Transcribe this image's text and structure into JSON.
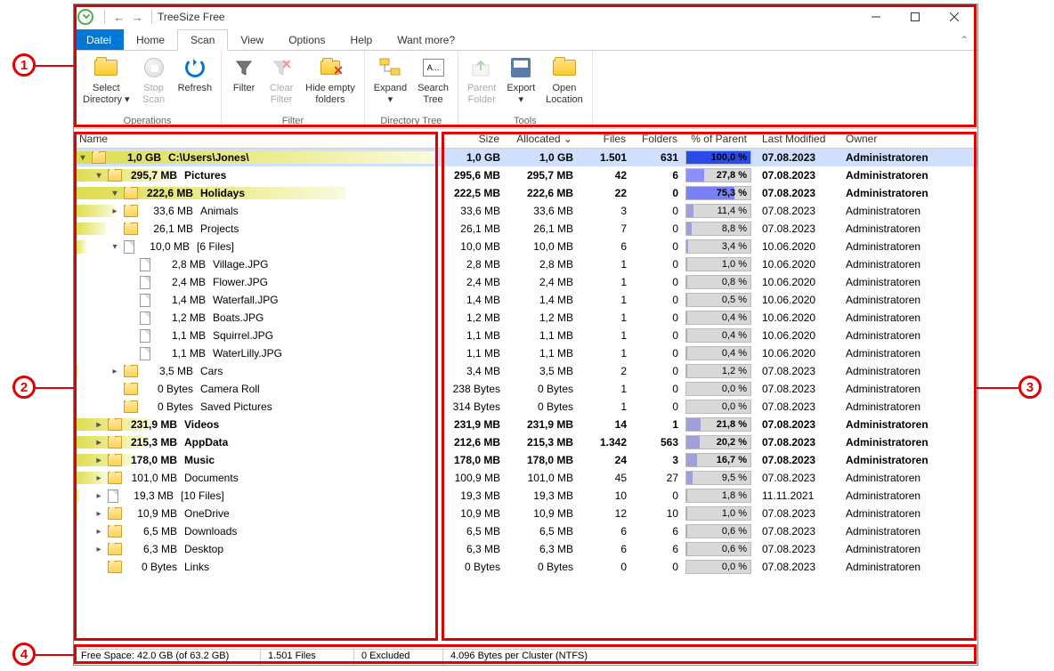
{
  "title": "TreeSize Free",
  "menu": {
    "file": "Datei",
    "home": "Home",
    "scan": "Scan",
    "view": "View",
    "options": "Options",
    "help": "Help",
    "wantmore": "Want more?"
  },
  "ribbon": {
    "groups": {
      "operations": {
        "label": "Operations",
        "items": {
          "select_dir": "Select\nDirectory ▾",
          "stop": "Stop\nScan",
          "refresh": "Refresh"
        }
      },
      "filter": {
        "label": "Filter",
        "items": {
          "filter": "Filter",
          "clear": "Clear\nFilter",
          "hide": "Hide empty\nfolders"
        }
      },
      "dirtree": {
        "label": "Directory Tree",
        "items": {
          "expand": "Expand\n▾",
          "search": "Search\nTree"
        }
      },
      "tools": {
        "label": "Tools",
        "items": {
          "parent": "Parent\nFolder",
          "export": "Export\n▾",
          "open": "Open\nLocation"
        }
      }
    }
  },
  "columns": {
    "name": "Name",
    "size": "Size",
    "alloc": "Allocated ⌄",
    "files": "Files",
    "folders": "Folders",
    "pct": "% of Parent ...",
    "mod": "Last Modified",
    "owner": "Owner"
  },
  "rows": [
    {
      "depth": 0,
      "chev": "▾",
      "type": "folder",
      "sizelabel": "1,0 GB",
      "name": "C:\\Users\\Jones\\",
      "csize": "1,0 GB",
      "calloc": "1,0 GB",
      "files": "1.501",
      "folders": "631",
      "pct": 100,
      "pcttxt": "100,0 %",
      "pctcolor": "#2b4be6",
      "mod": "07.08.2023",
      "owner": "Administratoren",
      "bold": true,
      "bg": 100,
      "sel": true
    },
    {
      "depth": 1,
      "chev": "▾",
      "type": "folder",
      "sizelabel": "295,7 MB",
      "name": "Pictures",
      "csize": "295,6 MB",
      "calloc": "295,7 MB",
      "files": "42",
      "folders": "6",
      "pct": 27.8,
      "pcttxt": "27,8 %",
      "pctcolor": "#8b8fff",
      "mod": "07.08.2023",
      "owner": "Administratoren",
      "bold": true,
      "bg": 27.8
    },
    {
      "depth": 2,
      "chev": "▾",
      "type": "folder",
      "sizelabel": "222,6 MB",
      "name": "Holidays",
      "csize": "222,5 MB",
      "calloc": "222,6 MB",
      "files": "22",
      "folders": "0",
      "pct": 75.3,
      "pcttxt": "75,3 %",
      "pctcolor": "#7b80f5",
      "mod": "07.08.2023",
      "owner": "Administratoren",
      "bold": true,
      "bg": 75.3
    },
    {
      "depth": 2,
      "chev": "▸",
      "type": "folder",
      "sizelabel": "33,6 MB",
      "name": "Animals",
      "csize": "33,6 MB",
      "calloc": "33,6 MB",
      "files": "3",
      "folders": "0",
      "pct": 11.4,
      "pcttxt": "11,4 %",
      "mod": "07.08.2023",
      "owner": "Administratoren",
      "bg": 11.4
    },
    {
      "depth": 2,
      "chev": "",
      "type": "folder",
      "sizelabel": "26,1 MB",
      "name": "Projects",
      "csize": "26,1 MB",
      "calloc": "26,1 MB",
      "files": "7",
      "folders": "0",
      "pct": 8.8,
      "pcttxt": "8,8 %",
      "mod": "07.08.2023",
      "owner": "Administratoren",
      "bg": 8.8
    },
    {
      "depth": 2,
      "chev": "▾",
      "type": "file",
      "sizelabel": "10,0 MB",
      "name": "[6 Files]",
      "csize": "10,0 MB",
      "calloc": "10,0 MB",
      "files": "6",
      "folders": "0",
      "pct": 3.4,
      "pcttxt": "3,4 %",
      "mod": "10.06.2020",
      "owner": "Administratoren",
      "bg": 3.4
    },
    {
      "depth": 3,
      "chev": "",
      "type": "file",
      "sizelabel": "2,8 MB",
      "name": "Village.JPG",
      "csize": "2,8 MB",
      "calloc": "2,8 MB",
      "files": "1",
      "folders": "0",
      "pct": 1.0,
      "pcttxt": "1,0 %",
      "mod": "10.06.2020",
      "owner": "Administratoren",
      "bg": 0
    },
    {
      "depth": 3,
      "chev": "",
      "type": "file",
      "sizelabel": "2,4 MB",
      "name": "Flower.JPG",
      "csize": "2,4 MB",
      "calloc": "2,4 MB",
      "files": "1",
      "folders": "0",
      "pct": 0.8,
      "pcttxt": "0,8 %",
      "mod": "10.06.2020",
      "owner": "Administratoren",
      "bg": 0
    },
    {
      "depth": 3,
      "chev": "",
      "type": "file",
      "sizelabel": "1,4 MB",
      "name": "Waterfall.JPG",
      "csize": "1,4 MB",
      "calloc": "1,4 MB",
      "files": "1",
      "folders": "0",
      "pct": 0.5,
      "pcttxt": "0,5 %",
      "mod": "10.06.2020",
      "owner": "Administratoren",
      "bg": 0
    },
    {
      "depth": 3,
      "chev": "",
      "type": "file",
      "sizelabel": "1,2 MB",
      "name": "Boats.JPG",
      "csize": "1,2 MB",
      "calloc": "1,2 MB",
      "files": "1",
      "folders": "0",
      "pct": 0.4,
      "pcttxt": "0,4 %",
      "mod": "10.06.2020",
      "owner": "Administratoren",
      "bg": 0
    },
    {
      "depth": 3,
      "chev": "",
      "type": "file",
      "sizelabel": "1,1 MB",
      "name": "Squirrel.JPG",
      "csize": "1,1 MB",
      "calloc": "1,1 MB",
      "files": "1",
      "folders": "0",
      "pct": 0.4,
      "pcttxt": "0,4 %",
      "mod": "10.06.2020",
      "owner": "Administratoren",
      "bg": 0
    },
    {
      "depth": 3,
      "chev": "",
      "type": "file",
      "sizelabel": "1,1 MB",
      "name": "WaterLilly.JPG",
      "csize": "1,1 MB",
      "calloc": "1,1 MB",
      "files": "1",
      "folders": "0",
      "pct": 0.4,
      "pcttxt": "0,4 %",
      "mod": "10.06.2020",
      "owner": "Administratoren",
      "bg": 0
    },
    {
      "depth": 2,
      "chev": "▸",
      "type": "folder",
      "sizelabel": "3,5 MB",
      "name": "Cars",
      "csize": "3,4 MB",
      "calloc": "3,5 MB",
      "files": "2",
      "folders": "0",
      "pct": 1.2,
      "pcttxt": "1,2 %",
      "mod": "07.08.2023",
      "owner": "Administratoren",
      "bg": 1.2
    },
    {
      "depth": 2,
      "chev": "",
      "type": "folder",
      "sizelabel": "0 Bytes",
      "name": "Camera Roll",
      "csize": "238 Bytes",
      "calloc": "0 Bytes",
      "files": "1",
      "folders": "0",
      "pct": 0,
      "pcttxt": "0,0 %",
      "mod": "07.08.2023",
      "owner": "Administratoren",
      "bg": 0
    },
    {
      "depth": 2,
      "chev": "",
      "type": "folder",
      "sizelabel": "0 Bytes",
      "name": "Saved Pictures",
      "csize": "314 Bytes",
      "calloc": "0 Bytes",
      "files": "1",
      "folders": "0",
      "pct": 0,
      "pcttxt": "0,0 %",
      "mod": "07.08.2023",
      "owner": "Administratoren",
      "bg": 0
    },
    {
      "depth": 1,
      "chev": "▸",
      "type": "folder",
      "sizelabel": "231,9 MB",
      "name": "Videos",
      "csize": "231,9 MB",
      "calloc": "231,9 MB",
      "files": "14",
      "folders": "1",
      "pct": 21.8,
      "pcttxt": "21,8 %",
      "mod": "07.08.2023",
      "owner": "Administratoren",
      "bold": true,
      "bg": 21.8
    },
    {
      "depth": 1,
      "chev": "▸",
      "type": "folder",
      "sizelabel": "215,3 MB",
      "name": "AppData",
      "csize": "212,6 MB",
      "calloc": "215,3 MB",
      "files": "1.342",
      "folders": "563",
      "pct": 20.2,
      "pcttxt": "20,2 %",
      "mod": "07.08.2023",
      "owner": "Administratoren",
      "bold": true,
      "bg": 20.2
    },
    {
      "depth": 1,
      "chev": "▸",
      "type": "folder",
      "sizelabel": "178,0 MB",
      "name": "Music",
      "csize": "178,0 MB",
      "calloc": "178,0 MB",
      "files": "24",
      "folders": "3",
      "pct": 16.7,
      "pcttxt": "16,7 %",
      "mod": "07.08.2023",
      "owner": "Administratoren",
      "bold": true,
      "bg": 16.7
    },
    {
      "depth": 1,
      "chev": "▸",
      "type": "folder",
      "sizelabel": "101,0 MB",
      "name": "Documents",
      "csize": "100,9 MB",
      "calloc": "101,0 MB",
      "files": "45",
      "folders": "27",
      "pct": 9.5,
      "pcttxt": "9,5 %",
      "mod": "07.08.2023",
      "owner": "Administratoren",
      "bg": 9.5
    },
    {
      "depth": 1,
      "chev": "▸",
      "type": "file",
      "sizelabel": "19,3 MB",
      "name": "[10 Files]",
      "csize": "19,3 MB",
      "calloc": "19,3 MB",
      "files": "10",
      "folders": "0",
      "pct": 1.8,
      "pcttxt": "1,8 %",
      "mod": "11.11.2021",
      "owner": "Administratoren",
      "bg": 1.8
    },
    {
      "depth": 1,
      "chev": "▸",
      "type": "folder",
      "sizelabel": "10,9 MB",
      "name": "OneDrive",
      "csize": "10,9 MB",
      "calloc": "10,9 MB",
      "files": "12",
      "folders": "10",
      "pct": 1.0,
      "pcttxt": "1,0 %",
      "mod": "07.08.2023",
      "owner": "Administratoren",
      "bg": 1.0
    },
    {
      "depth": 1,
      "chev": "▸",
      "type": "folder",
      "sizelabel": "6,5 MB",
      "name": "Downloads",
      "csize": "6,5 MB",
      "calloc": "6,5 MB",
      "files": "6",
      "folders": "6",
      "pct": 0.6,
      "pcttxt": "0,6 %",
      "mod": "07.08.2023",
      "owner": "Administratoren",
      "bg": 0.6
    },
    {
      "depth": 1,
      "chev": "▸",
      "type": "folder",
      "sizelabel": "6,3 MB",
      "name": "Desktop",
      "csize": "6,3 MB",
      "calloc": "6,3 MB",
      "files": "6",
      "folders": "6",
      "pct": 0.6,
      "pcttxt": "0,6 %",
      "mod": "07.08.2023",
      "owner": "Administratoren",
      "bg": 0.6
    },
    {
      "depth": 1,
      "chev": "",
      "type": "folder",
      "sizelabel": "0 Bytes",
      "name": "Links",
      "csize": "0 Bytes",
      "calloc": "0 Bytes",
      "files": "0",
      "folders": "0",
      "pct": 0,
      "pcttxt": "0,0 %",
      "mod": "07.08.2023",
      "owner": "Administratoren",
      "bg": 0
    }
  ],
  "status": {
    "free": "Free Space: 42.0 GB  (of 63.2 GB)",
    "files": "1.501 Files",
    "excl": "0 Excluded",
    "cluster": "4.096 Bytes per Cluster (NTFS)"
  },
  "annotations": {
    "a1": "1",
    "a2": "2",
    "a3": "3",
    "a4": "4"
  }
}
